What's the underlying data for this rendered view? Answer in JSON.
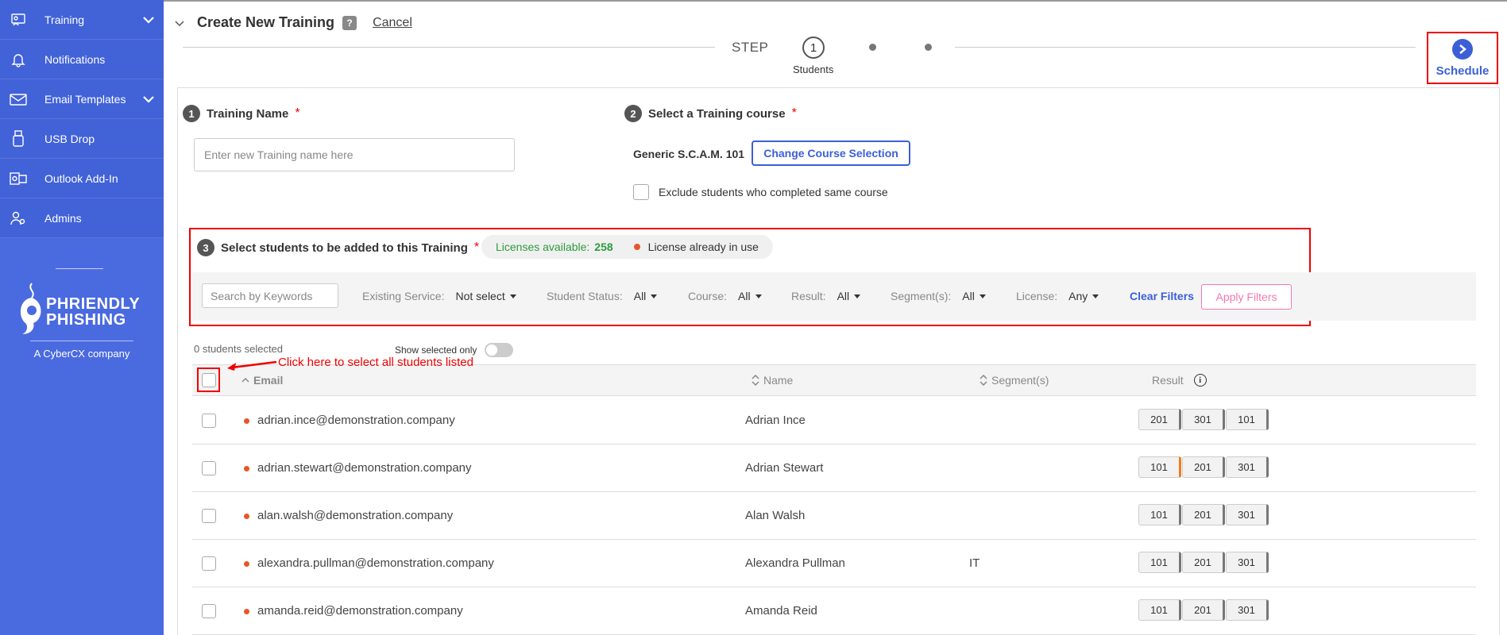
{
  "sidebar": {
    "items": [
      {
        "label": "Training",
        "icon": "training-icon",
        "has_chevron": true
      },
      {
        "label": "Notifications",
        "icon": "bell-icon",
        "has_chevron": false
      },
      {
        "label": "Email Templates",
        "icon": "mail-icon",
        "has_chevron": true
      },
      {
        "label": "USB Drop",
        "icon": "usb-icon",
        "has_chevron": false
      },
      {
        "label": "Outlook Add-In",
        "icon": "outlook-icon",
        "has_chevron": false
      },
      {
        "label": "Admins",
        "icon": "admins-icon",
        "has_chevron": false
      }
    ],
    "logo_text_line1": "PHRIENDLY",
    "logo_text_line2": "PHISHING",
    "logo_sub": "A CyberCX company"
  },
  "header": {
    "title": "Create New Training",
    "help": "?",
    "cancel": "Cancel"
  },
  "stepper": {
    "step_label": "STEP",
    "current_step_number": "1",
    "current_step_name": "Students",
    "schedule_label": "Schedule"
  },
  "section1": {
    "number": "1",
    "title": "Training Name",
    "required": "*",
    "placeholder": "Enter new Training name here"
  },
  "section2": {
    "number": "2",
    "title": "Select a Training course",
    "required": "*",
    "course_name": "Generic S.C.A.M. 101",
    "change_button": "Change Course Selection",
    "exclude_label": "Exclude students who completed same course"
  },
  "section3": {
    "number": "3",
    "title": "Select students to be added to this Training",
    "required": "*",
    "licenses_label": "Licenses available:",
    "licenses_count": "258",
    "license_in_use": "License already in use"
  },
  "filters": {
    "search_placeholder": "Search by Keywords",
    "existing_service_label": "Existing Service:",
    "existing_service_value": "Not select",
    "student_status_label": "Student Status:",
    "student_status_value": "All",
    "course_label": "Course:",
    "course_value": "All",
    "result_label": "Result:",
    "result_value": "All",
    "segments_label": "Segment(s):",
    "segments_value": "All",
    "license_label": "License:",
    "license_value": "Any",
    "clear_filters": "Clear Filters",
    "apply_filters": "Apply Filters"
  },
  "selection": {
    "count_text": "0 students selected",
    "show_selected_only": "Show selected only"
  },
  "annotation": {
    "text": "Click here to select all students listed",
    "color": "#e00000"
  },
  "table": {
    "columns": {
      "email": "Email",
      "name": "Name",
      "segments": "Segment(s)",
      "result": "Result"
    },
    "rows": [
      {
        "email": "adrian.ince@demonstration.company",
        "name": "Adrian Ince",
        "segment": "",
        "results": [
          "201",
          "301",
          "101"
        ]
      },
      {
        "email": "adrian.stewart@demonstration.company",
        "name": "Adrian Stewart",
        "segment": "",
        "results": [
          "101",
          "201",
          "301"
        ]
      },
      {
        "email": "alan.walsh@demonstration.company",
        "name": "Alan Walsh",
        "segment": "",
        "results": [
          "101",
          "201",
          "301"
        ]
      },
      {
        "email": "alexandra.pullman@demonstration.company",
        "name": "Alexandra Pullman",
        "segment": "IT",
        "results": [
          "101",
          "201",
          "301"
        ]
      },
      {
        "email": "amanda.reid@demonstration.company",
        "name": "Amanda Reid",
        "segment": "",
        "results": [
          "101",
          "201",
          "301"
        ]
      }
    ]
  },
  "colors": {
    "sidebar": "#4a6ae0",
    "accent": "#3c5fd8",
    "highlight": "#e00000",
    "license_green": "#2e9b3c",
    "in_use_dot": "#e8552a",
    "apply_pink": "#f07ab0"
  }
}
